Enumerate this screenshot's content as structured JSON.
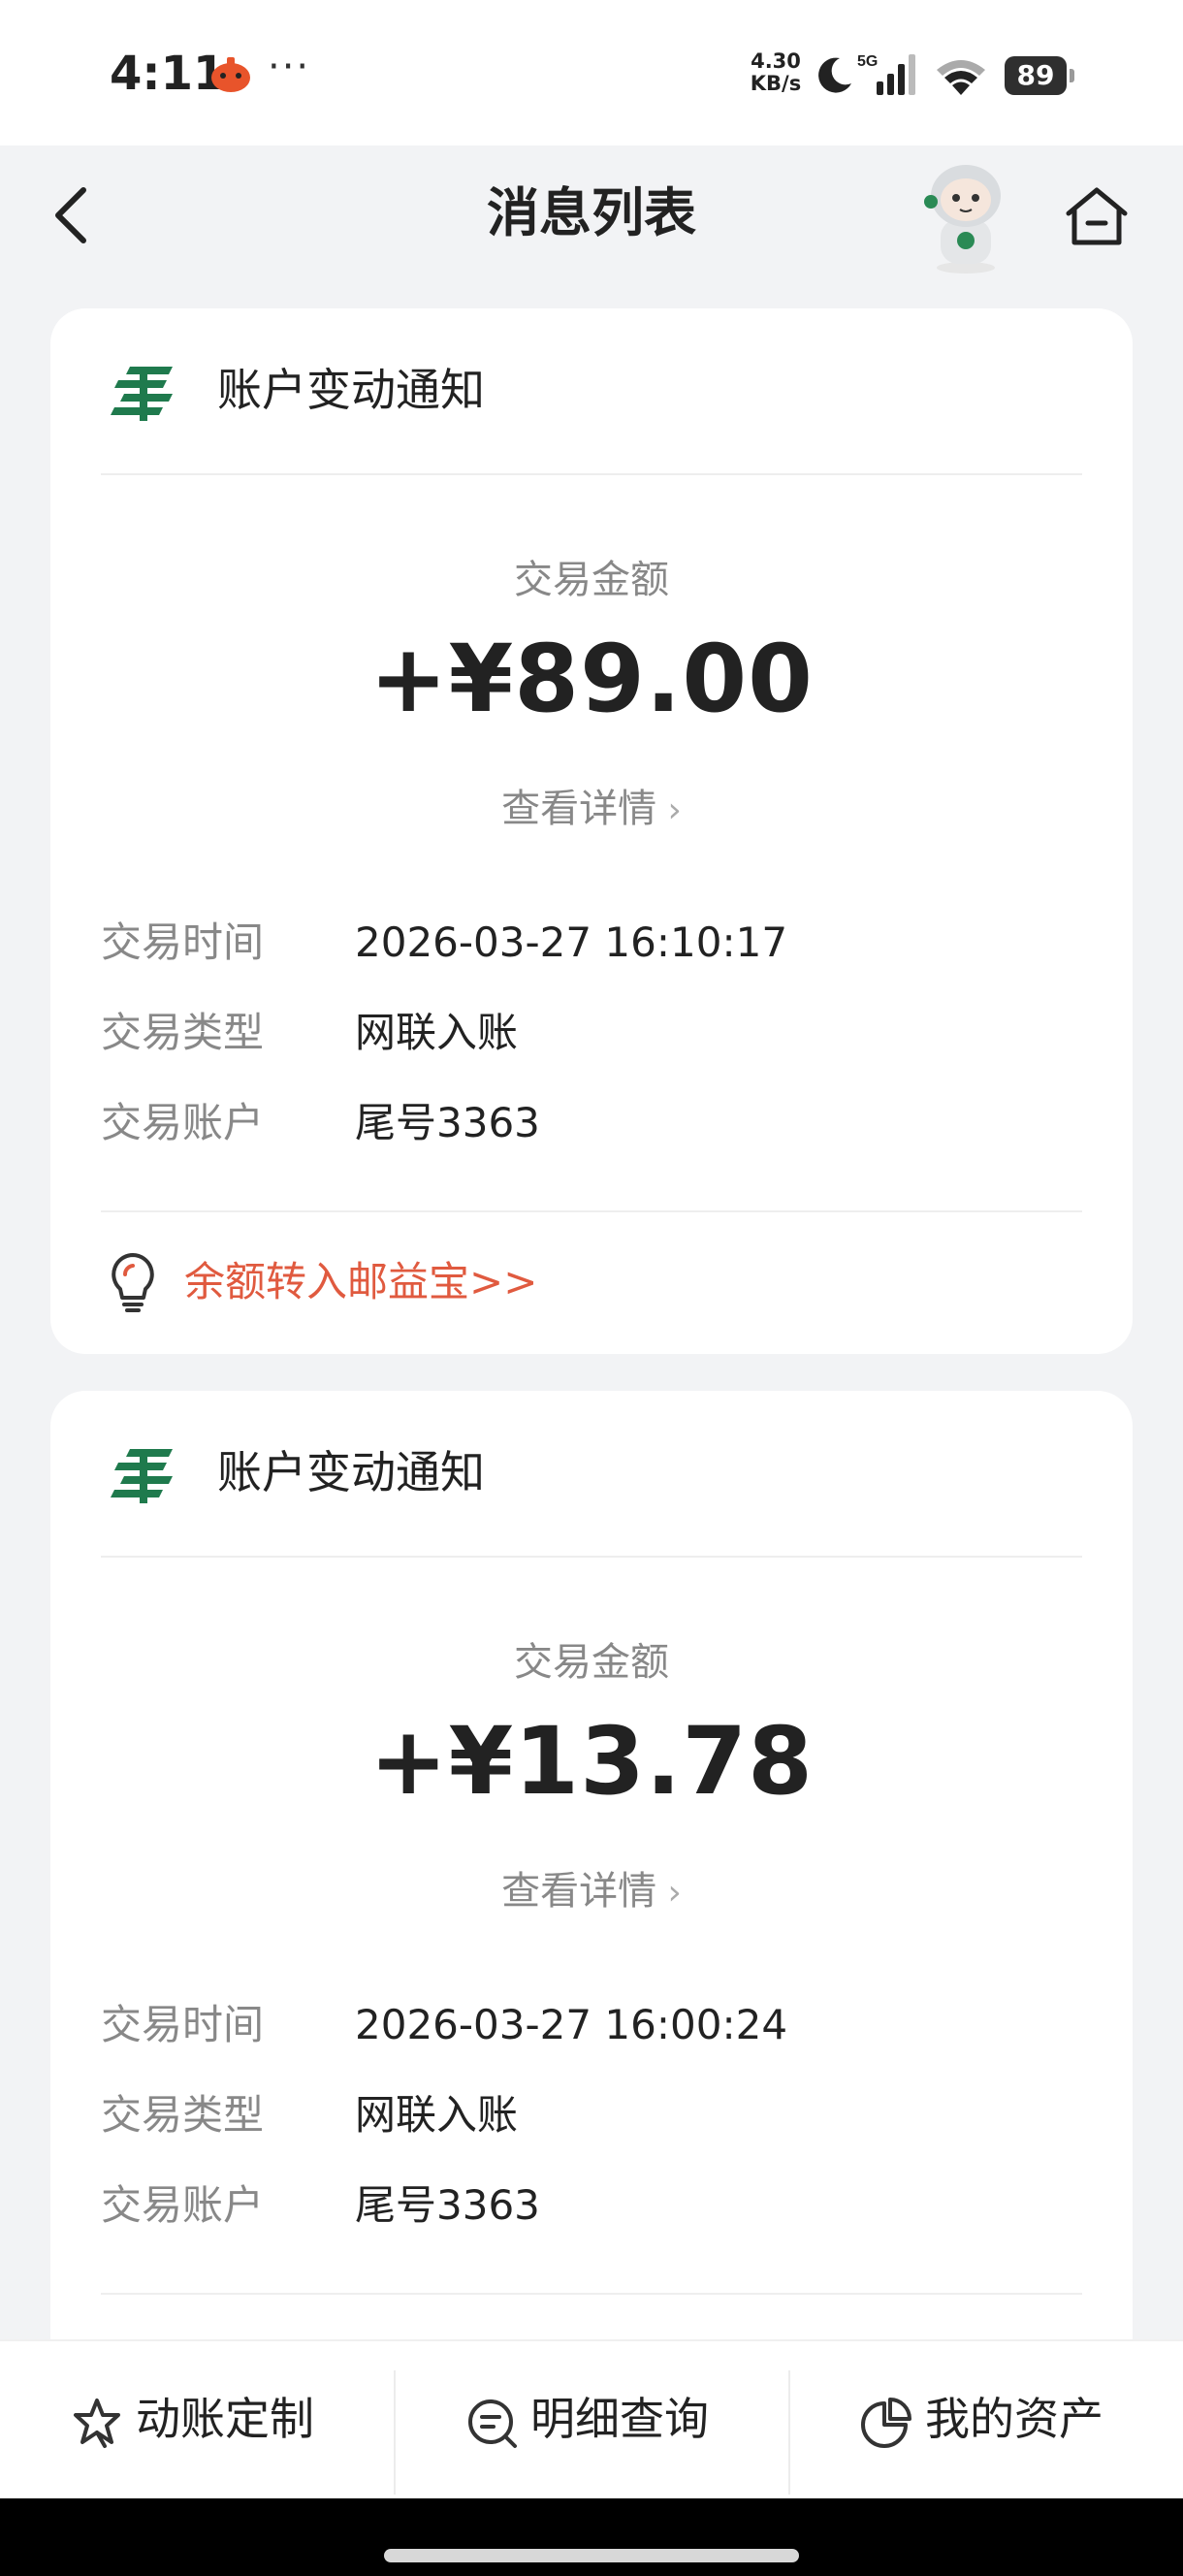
{
  "status_bar": {
    "time": "4:11",
    "dots": "···",
    "speed_value": "4.30",
    "speed_unit": "KB/s",
    "network": "5G",
    "battery": "89"
  },
  "header": {
    "title": "消息列表"
  },
  "notifications": [
    {
      "title": "账户变动通知",
      "amount_label": "交易金额",
      "amount": "+¥89.00",
      "detail_link": "查看详情",
      "rows": [
        {
          "label": "交易时间",
          "value": "2026-03-27 16:10:17"
        },
        {
          "label": "交易类型",
          "value": "网联入账"
        },
        {
          "label": "交易账户",
          "value": "尾号3363"
        }
      ],
      "promo": "余额转入邮益宝>>"
    },
    {
      "title": "账户变动通知",
      "amount_label": "交易金额",
      "amount": "+¥13.78",
      "detail_link": "查看详情",
      "rows": [
        {
          "label": "交易时间",
          "value": "2026-03-27 16:00:24"
        },
        {
          "label": "交易类型",
          "value": "网联入账"
        },
        {
          "label": "交易账户",
          "value": "尾号3363"
        }
      ]
    }
  ],
  "bottom_tabs": [
    {
      "label": "动账定制",
      "icon": "star-badge-icon"
    },
    {
      "label": "明细查询",
      "icon": "search-list-icon"
    },
    {
      "label": "我的资产",
      "icon": "pie-chart-icon"
    }
  ],
  "colors": {
    "brand_green": "#1f7a4d",
    "promo_red": "#e05a3f",
    "background": "#f2f3f5"
  }
}
